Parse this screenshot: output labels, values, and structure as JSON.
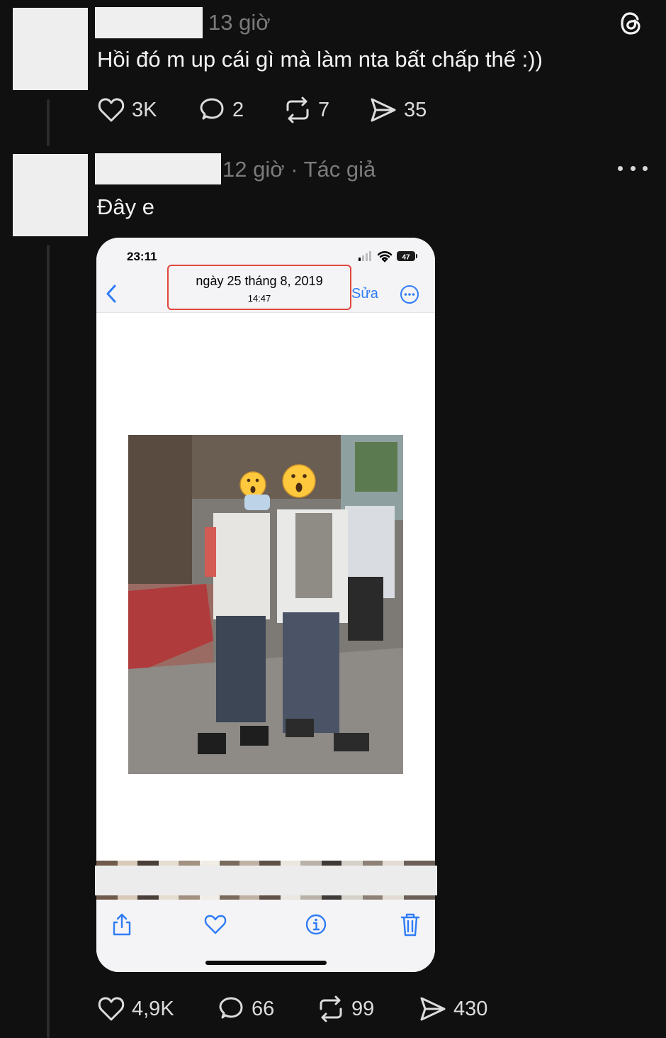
{
  "comment1": {
    "time": "13 giờ",
    "text": "Hồi đó m up cái gì mà làm nta bất chấp thế :))",
    "likes": "3K",
    "replies": "2",
    "reposts": "7",
    "shares": "35"
  },
  "comment2": {
    "time": "12 giờ",
    "separator": "·",
    "author_tag": "Tác giả",
    "text": "Đây e",
    "likes": "4,9K",
    "replies": "66",
    "reposts": "99",
    "shares": "430"
  },
  "phone_screenshot": {
    "status_time": "23:11",
    "battery": "47",
    "date": "ngày 25 tháng 8, 2019",
    "time": "14:47",
    "edit_label": "Sửa"
  },
  "icons": {
    "app": "threads-logo-icon",
    "more": "more-dots-icon",
    "like": "heart-icon",
    "reply": "comment-bubble-icon",
    "repost": "repost-icon",
    "share": "send-icon",
    "back": "chevron-left-icon",
    "photo_share": "share-icon",
    "photo_favorite": "heart-icon",
    "photo_info": "info-icon",
    "photo_delete": "trash-icon"
  },
  "colors": {
    "background": "#101010",
    "text": "#f3f3f3",
    "muted": "#7b7b7b",
    "ios_blue": "#2f7cf6",
    "highlight_red": "#e0463c"
  }
}
